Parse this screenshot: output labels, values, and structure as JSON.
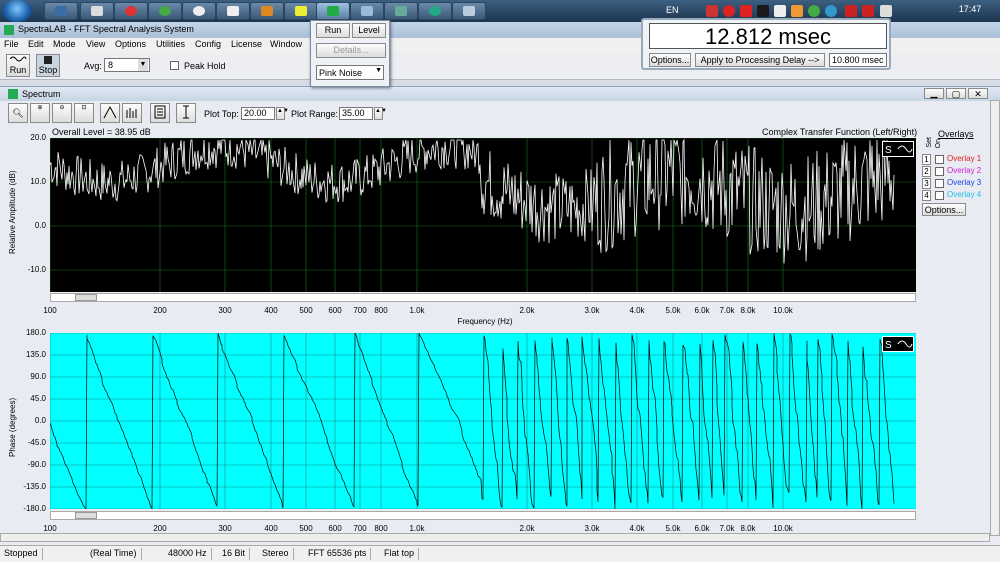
{
  "taskbar": {
    "language": "EN",
    "clock": "17:47"
  },
  "window": {
    "title": "SpectraLAB - FFT Spectral Analysis System"
  },
  "menu": [
    "File",
    "Edit",
    "Mode",
    "View",
    "Options",
    "Utilities",
    "Config",
    "License",
    "Window"
  ],
  "toolbar": {
    "run": "Run",
    "stop": "Stop",
    "avg_label": "Avg:",
    "avg_value": "8",
    "peak_hold": "Peak Hold"
  },
  "popup": {
    "run": "Run",
    "level": "Level",
    "details": "Details...",
    "noise": "Pink Noise"
  },
  "delay": {
    "value": "12.812 msec",
    "options": "Options...",
    "apply": "Apply to Processing Delay -->",
    "field": "10.800 msec"
  },
  "spectrum": {
    "title": "Spectrum",
    "plot_top_label": "Plot Top:",
    "plot_top_value": "20.00",
    "plot_range_label": "Plot Range:",
    "plot_range_value": "35.00",
    "overall_level": "Overall Level = 38.95 dB",
    "transfer": "Complex Transfer Function (Left/Right)",
    "ylabel_top": "Relative Amplitude (dB)",
    "ylabel_bot": "Phase (degrees)",
    "xlabel": "Frequency (Hz)",
    "overlays_header": "Overlays",
    "set_label": "Set",
    "on_label": "On",
    "overlays": [
      {
        "n": "1",
        "name": "Overlay 1",
        "color": "#e02020"
      },
      {
        "n": "2",
        "name": "Overlay 2",
        "color": "#d020d0"
      },
      {
        "n": "3",
        "name": "Overlay 3",
        "color": "#2040e0"
      },
      {
        "n": "4",
        "name": "Overlay 4",
        "color": "#20c0e0"
      }
    ],
    "options": "Options..."
  },
  "chart_data": [
    {
      "type": "line",
      "title": "",
      "xlabel": "Frequency (Hz)",
      "ylabel": "Relative Amplitude (dB)",
      "ylim": [
        -15,
        20
      ],
      "yticks": [
        "20.0",
        "10.0",
        "0.0",
        "-10.0"
      ],
      "xticks": [
        "100",
        "200",
        "300",
        "400",
        "500",
        "600",
        "700",
        "800",
        "1.0k",
        "2.0k",
        "3.0k",
        "4.0k",
        "5.0k",
        "6.0k",
        "7.0k",
        "8.0k",
        "10.0k"
      ],
      "grid": true
    },
    {
      "type": "line",
      "title": "",
      "xlabel": "Frequency (Hz)",
      "ylabel": "Phase (degrees)",
      "ylim": [
        -180,
        180
      ],
      "yticks": [
        "180.0",
        "135.0",
        "90.0",
        "45.0",
        "0.0",
        "-45.0",
        "-90.0",
        "-135.0",
        "-180.0"
      ],
      "xticks": [
        "100",
        "200",
        "300",
        "400",
        "500",
        "600",
        "700",
        "800",
        "1.0k",
        "2.0k",
        "3.0k",
        "4.0k",
        "5.0k",
        "6.0k",
        "7.0k",
        "8.0k",
        "10.0k"
      ],
      "grid": true
    }
  ],
  "status": {
    "state": "Stopped",
    "mode": "(Real Time)",
    "rate": "48000 Hz",
    "bits": "16 Bit",
    "channels": "Stereo",
    "fft": "FFT 65536 pts",
    "window": "Flat top"
  }
}
